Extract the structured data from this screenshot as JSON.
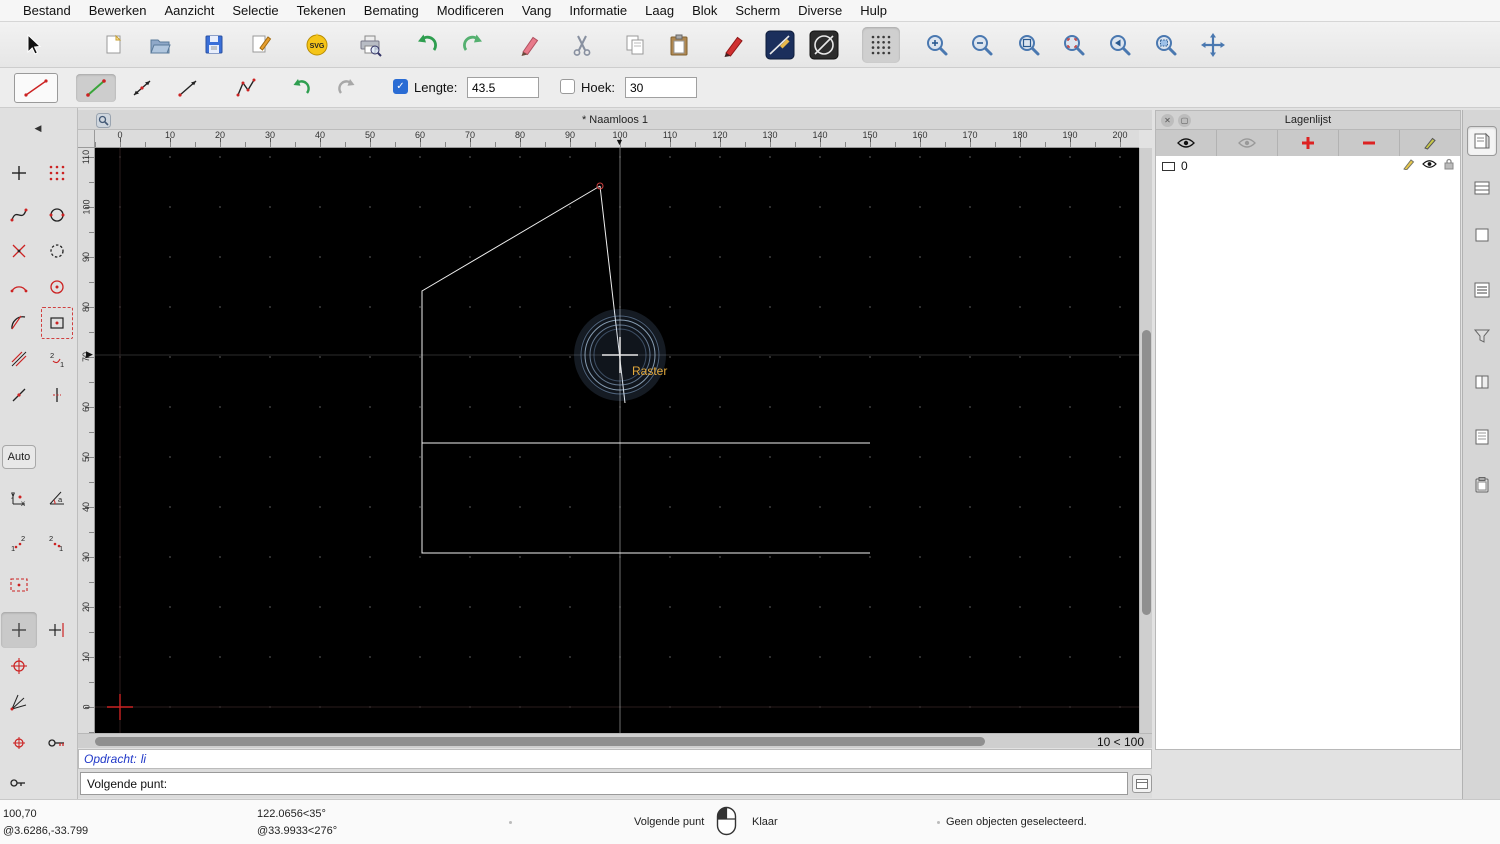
{
  "colors": {
    "accent_blue": "#2a6cd4",
    "canvas_background": "#000000",
    "snap_indicator_blue": "#8fb8e8",
    "snap_label_yellow": "#e3a93c",
    "origin_cross_red": "#cc2222",
    "shape_line_white": "#f0f0f0"
  },
  "menubar": {
    "items": [
      "Bestand",
      "Bewerken",
      "Aanzicht",
      "Selectie",
      "Tekenen",
      "Bemating",
      "Modificeren",
      "Vang",
      "Informatie",
      "Laag",
      "Blok",
      "Scherm",
      "Diverse",
      "Hulp"
    ]
  },
  "toolbar_main": {
    "svg_badge": "SVG",
    "icons": [
      "cursor-icon",
      "new-document-icon",
      "open-file-icon",
      "save-icon",
      "edit-drawing-icon",
      "svg-export-icon",
      "print-preview-icon",
      "undo-icon",
      "redo-icon",
      "delete-pen-icon",
      "cut-icon",
      "copy-icon",
      "paste-icon",
      "modify-pen-icon",
      "line-properties-icon",
      "draft-rendering-icon",
      "grid-toggle-icon",
      "zoom-in-icon",
      "zoom-out-icon",
      "zoom-auto-icon",
      "zoom-selection-icon",
      "zoom-previous-icon",
      "zoom-window-icon",
      "pan-icon"
    ]
  },
  "toolbar_tool": {
    "length_label": "Lengte:",
    "length_value": "43.5",
    "length_checked": true,
    "angle_label": "Hoek:",
    "angle_value": "30",
    "angle_checked": false
  },
  "palette": {
    "auto_label": "Auto",
    "collapse_icon": "◀"
  },
  "document": {
    "title": "* Naamloos 1",
    "ruler_top_labels": [
      "0",
      "10",
      "20",
      "30",
      "40",
      "50",
      "60",
      "70",
      "80",
      "90",
      "100",
      "110",
      "120",
      "130",
      "140",
      "150",
      "160",
      "170",
      "180",
      "190",
      "200"
    ],
    "ruler_left_labels": [
      "110",
      "100",
      "90",
      "80",
      "70",
      "60",
      "50",
      "40",
      "30",
      "20",
      "10",
      "0"
    ],
    "snap_tooltip": "Raster",
    "zoom_status": "10 < 100"
  },
  "command_line": {
    "history_prefix": "Opdracht:",
    "history_command": "li",
    "prompt": "Volgende punt:"
  },
  "layer_panel": {
    "title": "Lagenlijst",
    "layers": [
      {
        "name": "0"
      }
    ]
  },
  "statusbar": {
    "absolute_coordinate": "100,70",
    "relative_coordinate": "@3.6286,-33.799",
    "absolute_polar": "122.0656<35°",
    "relative_polar": "@33.9933<276°",
    "left_button_action": "Volgende punt",
    "right_button_action": "Klaar",
    "selection_info": "Geen objecten geselecteerd."
  }
}
